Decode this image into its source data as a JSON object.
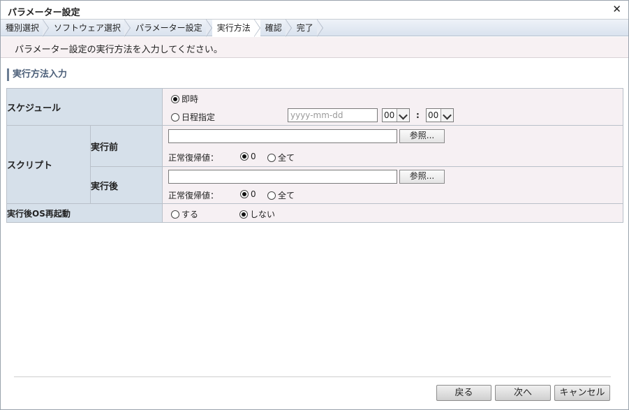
{
  "window": {
    "title": "パラメーター設定"
  },
  "steps": [
    "種別選択",
    "ソフトウェア選択",
    "パラメーター設定",
    "実行方法",
    "確認",
    "完了"
  ],
  "current_step": "実行方法",
  "info": "パラメーター設定の実行方法を入力してください。",
  "section_title": "実行方法入力",
  "schedule": {
    "label": "スケジュール",
    "immediate_label": "即時",
    "date_label": "日程指定",
    "date_placeholder": "yyyy-mm-dd",
    "hour_value": "00",
    "colon": ":",
    "minute_value": "00"
  },
  "script": {
    "label": "スクリプト",
    "before": {
      "label": "実行前",
      "path_value": "",
      "browse_label": "参照...",
      "return_label": "正常復帰値：",
      "opt_zero": "0",
      "opt_all": "全て"
    },
    "after": {
      "label": "実行後",
      "path_value": "",
      "browse_label": "参照...",
      "return_label": "正常復帰値：",
      "opt_zero": "0",
      "opt_all": "全て"
    }
  },
  "reboot": {
    "label": "実行後OS再起動",
    "yes_label": "する",
    "no_label": "しない"
  },
  "footer": {
    "back": "戻る",
    "next": "次へ",
    "cancel": "キャンセル"
  }
}
